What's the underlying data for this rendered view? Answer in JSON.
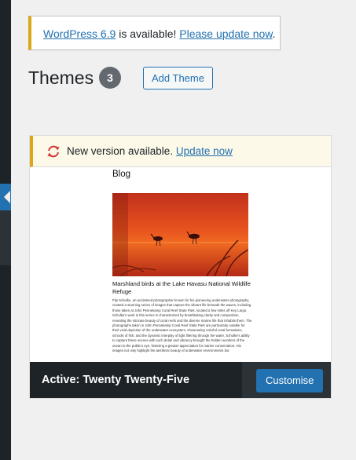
{
  "notice": {
    "update_link": "WordPress 6.9",
    "middle_text": " is available! ",
    "action_link": "Please update now",
    "end_text": "."
  },
  "header": {
    "title": "Themes",
    "count": "3",
    "add_button": "Add Theme"
  },
  "theme": {
    "update_text": "New version available. ",
    "update_link": "Update now",
    "active_label": "Active:",
    "name": " Twenty Twenty-Five",
    "customise_button": "Customise",
    "preview": {
      "blog_title": "Blog",
      "headline": "Marshland birds at the Lake Havasu National Wildlife Refuge",
      "body": "Flip Schulke, an acclaimed photographer known for his pioneering underwater photography, created a stunning series of images that capture the vibrant life beneath the waves, including those taken at John Pennekamp Coral Reef State Park, located a few miles off Key Largo. Schulke's work in this series is characterized by breathtaking clarity and composition, revealing the intricate beauty of coral reefs and the diverse marine life that inhabits them. The photographs taken in John Pennekamp Coral Reef State Park are particularly notable for their vivid depiction of the underwater ecosystem, showcasing colorful coral formations, schools of fish, and the dynamic interplay of light filtering through the water. Schulke's ability to capture these scenes with such detail and vibrancy brought the hidden wonders of the ocean to the public's eye, fostering a greater appreciation for marine conservation. His images not only highlight the aesthetic beauty of underwater environments but"
    }
  },
  "colors": {
    "accent": "#2271b1",
    "warning": "#dba617",
    "admin_dark": "#1d2327",
    "update_icon": "#d63638"
  }
}
